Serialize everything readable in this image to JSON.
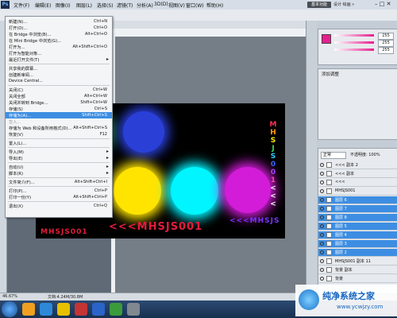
{
  "app": {
    "logo": "Ps",
    "workspace_button": "基本功能",
    "workspace_links": "设计  绘画  »",
    "window_controls": "– □ ✕"
  },
  "menubar": {
    "items": [
      "文件(F)",
      "编辑(E)",
      "图像(I)",
      "图层(L)",
      "选择(S)",
      "滤镜(T)",
      "分析(A)",
      "3D(D)",
      "视图(V)",
      "窗口(W)",
      "帮助(H)"
    ]
  },
  "file_menu": {
    "items": [
      {
        "label": "新建(N)...",
        "shortcut": "Ctrl+N"
      },
      {
        "label": "打开(O)...",
        "shortcut": "Ctrl+O"
      },
      {
        "label": "在 Bridge 中浏览(B)...",
        "shortcut": "Alt+Ctrl+O"
      },
      {
        "label": "在 Mini Bridge 中浏览(G)...",
        "shortcut": ""
      },
      {
        "label": "打开为...",
        "shortcut": "Alt+Shift+Ctrl+O"
      },
      {
        "label": "打开为智能对象...",
        "shortcut": ""
      },
      {
        "label": "最近打开文件(T)",
        "shortcut": "",
        "submenu": true
      },
      {
        "sep": true
      },
      {
        "label": "共享我的屏幕...",
        "shortcut": ""
      },
      {
        "label": "创建新审阅...",
        "shortcut": ""
      },
      {
        "label": "Device Central...",
        "shortcut": ""
      },
      {
        "sep": true
      },
      {
        "label": "关闭(C)",
        "shortcut": "Ctrl+W"
      },
      {
        "label": "关闭全部",
        "shortcut": "Alt+Ctrl+W"
      },
      {
        "label": "关闭并转到 Bridge...",
        "shortcut": "Shift+Ctrl+W"
      },
      {
        "label": "存储(S)",
        "shortcut": "Ctrl+S"
      },
      {
        "label": "存储为(A)...",
        "shortcut": "Shift+Ctrl+S",
        "highlight": true
      },
      {
        "label": "签入...",
        "shortcut": "",
        "disabled": true
      },
      {
        "label": "存储为 Web 和设备所用格式(D)...",
        "shortcut": "Alt+Shift+Ctrl+S"
      },
      {
        "label": "恢复(V)",
        "shortcut": "F12"
      },
      {
        "sep": true
      },
      {
        "label": "置入(L)...",
        "shortcut": ""
      },
      {
        "sep": true
      },
      {
        "label": "导入(M)",
        "shortcut": "",
        "submenu": true
      },
      {
        "label": "导出(E)",
        "shortcut": "",
        "submenu": true
      },
      {
        "sep": true
      },
      {
        "label": "自动(U)",
        "shortcut": "",
        "submenu": true
      },
      {
        "label": "脚本(R)",
        "shortcut": "",
        "submenu": true
      },
      {
        "sep": true
      },
      {
        "label": "文件简介(F)...",
        "shortcut": "Alt+Shift+Ctrl+I"
      },
      {
        "sep": true
      },
      {
        "label": "打印(P)...",
        "shortcut": "Ctrl+P"
      },
      {
        "label": "打印一份(Y)",
        "shortcut": "Alt+Shift+Ctrl+P"
      },
      {
        "sep": true
      },
      {
        "label": "退出(X)",
        "shortcut": "Ctrl+Q"
      }
    ]
  },
  "canvas": {
    "main_text": "<<<MHSJS001",
    "small_text_left": "MHSJS001",
    "small_text_right": "<<<MHSJS",
    "vertical_text": "MHSJS001<<<"
  },
  "status": {
    "zoom": "46.67%",
    "doc": "文档:4.24M/30.8M"
  },
  "color_panel": {
    "values": [
      "255",
      "255",
      "255"
    ],
    "colors": [
      "#e81e8f",
      "#e81e8f",
      "#e81e8f"
    ]
  },
  "adjustments": {
    "title": "添加调整"
  },
  "layers": {
    "blend_mode": "正常",
    "opacity": "不透明度: 100%",
    "rows": [
      {
        "name": "<<< 副本 2",
        "selected": false
      },
      {
        "name": "<<< 副本",
        "selected": false
      },
      {
        "name": "<<<",
        "selected": false
      },
      {
        "name": "MHSJS001",
        "selected": false
      },
      {
        "name": "图层 6",
        "selected": true
      },
      {
        "name": "图层 7",
        "selected": true
      },
      {
        "name": "图层 8",
        "selected": true
      },
      {
        "name": "图层 5",
        "selected": true
      },
      {
        "name": "图层 4",
        "selected": true
      },
      {
        "name": "图层 3",
        "selected": true
      },
      {
        "name": "图层 2",
        "selected": true
      },
      {
        "name": "MHSJS001 副本 11",
        "selected": false
      },
      {
        "name": "背景 副本",
        "selected": false
      },
      {
        "name": "背景",
        "selected": false
      }
    ]
  },
  "glow_colors": [
    "#ff7a00",
    "#1fbf4a",
    "#2a3fd6",
    "#ffe400",
    "#00f5ff",
    "#d21cd8"
  ],
  "watermark": {
    "text": "纯净系统之家",
    "url": "www.ycwjzy.com"
  },
  "taskbar": {
    "icons": [
      "ie-icon",
      "folder-icon",
      "media-player-icon",
      "photoshop-icon",
      "ie-icon-2",
      "folder-icon-2",
      "app-icon"
    ],
    "colors": [
      "#f0a020",
      "#2d88d8",
      "#e6c100",
      "#c43434",
      "#2a64c8",
      "#3b9b3b",
      "#808890"
    ]
  }
}
